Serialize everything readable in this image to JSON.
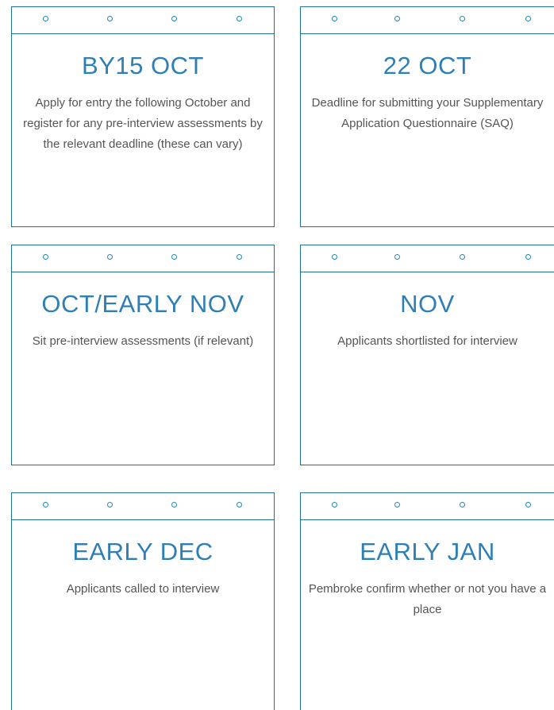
{
  "cards": [
    {
      "date": "BY15 OCT",
      "description": "Apply for entry the following October and register for any pre-interview assessments by the relevant deadline (these can vary)"
    },
    {
      "date": "22 OCT",
      "description": "Deadline for submitting your Supplementary Application Questionnaire (SAQ)"
    },
    {
      "date": "OCT/EARLY NOV",
      "description": "Sit pre-interview assessments (if relevant)"
    },
    {
      "date": "NOV",
      "description": "Applicants shortlisted for interview"
    },
    {
      "date": "EARLY DEC",
      "description": "Applicants called to interview"
    },
    {
      "date": "EARLY JAN",
      "description": "Pembroke confirm whether or not you have a place"
    }
  ],
  "colors": {
    "border": "#1f6f9a",
    "date_text": "#2f7fb5",
    "body_text": "#555555",
    "ring": "#2a86b4"
  },
  "icons": {
    "binder_ring": "binder-ring-icon"
  }
}
